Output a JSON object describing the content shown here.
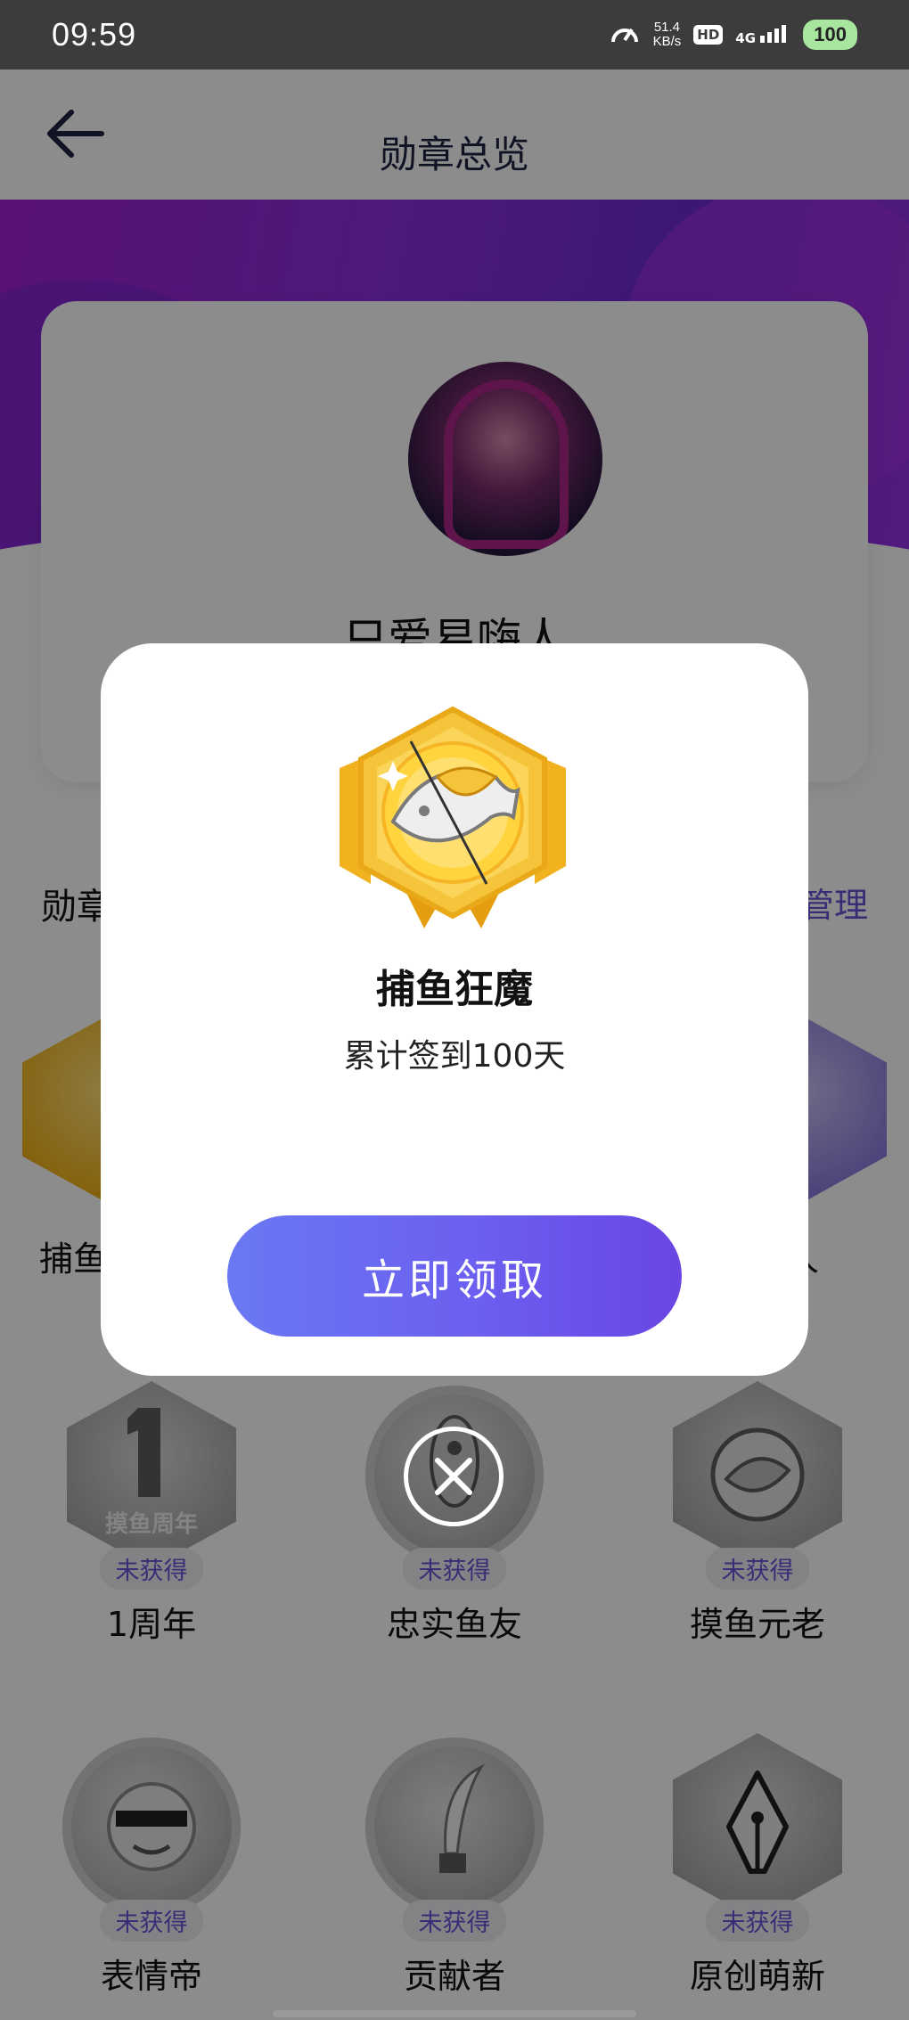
{
  "status_bar": {
    "time": "09:59",
    "speed_value": "51.4",
    "speed_unit": "KB/s",
    "hd": "HD",
    "network": "4G",
    "battery": "100"
  },
  "header": {
    "title": "勋章总览"
  },
  "profile": {
    "nickname": "只爱易嗨人"
  },
  "section": {
    "title": "勋章",
    "manage": "管理"
  },
  "badges": [
    {
      "name": "捕鱼狂魔",
      "status": ""
    },
    {
      "name": "",
      "status": ""
    },
    {
      "name": "人",
      "status": ""
    },
    {
      "name": "1周年",
      "status": "未获得",
      "medal_text": "摸鱼周年"
    },
    {
      "name": "忠实鱼友",
      "status": "未获得"
    },
    {
      "name": "摸鱼元老",
      "status": "未获得"
    },
    {
      "name": "表情帝",
      "status": "未获得"
    },
    {
      "name": "贡献者",
      "status": "未获得"
    },
    {
      "name": "原创萌新",
      "status": "未获得"
    }
  ],
  "modal": {
    "badge_name": "捕鱼狂魔",
    "description": "累计签到100天",
    "claim_button": "立即领取"
  },
  "colors": {
    "accent": "#6a53d8",
    "button_start": "#6a78f2",
    "button_end": "#6a45e3",
    "hero_purple": "#8d2fe0",
    "gold": "#f2b51d"
  }
}
